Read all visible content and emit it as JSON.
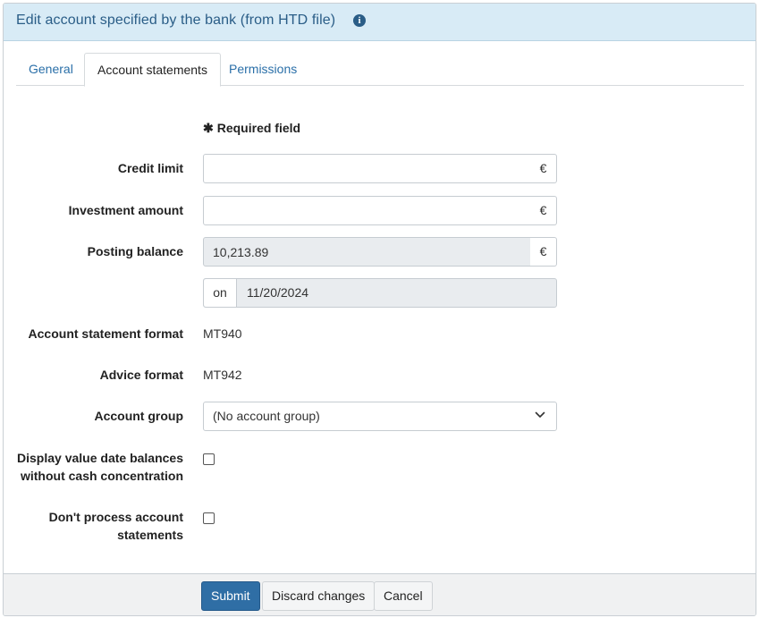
{
  "header": {
    "title": "Edit account specified by the bank (from HTD file)",
    "info_icon": "i"
  },
  "tabs": [
    {
      "label": "General",
      "active": false
    },
    {
      "label": "Account statements",
      "active": true
    },
    {
      "label": "Permissions",
      "active": false
    }
  ],
  "form": {
    "required_star": "✱",
    "required_label": "Required field",
    "credit_limit": {
      "label": "Credit limit",
      "value": "",
      "currency": "€"
    },
    "investment_amount": {
      "label": "Investment amount",
      "value": "",
      "currency": "€"
    },
    "posting_balance": {
      "label": "Posting balance",
      "value": "10,213.89",
      "currency": "€"
    },
    "balance_date": {
      "prefix": "on",
      "value": "11/20/2024"
    },
    "statement_format": {
      "label": "Account statement format",
      "value": "MT940"
    },
    "advice_format": {
      "label": "Advice format",
      "value": "MT942"
    },
    "account_group": {
      "label": "Account group",
      "selected": "(No account group)"
    },
    "value_date_balances": {
      "label_line1": "Display value date balances",
      "label_line2": "without cash concentration",
      "checked": false
    },
    "dont_process": {
      "label_line1": "Don't process account",
      "label_line2": "statements",
      "checked": false
    }
  },
  "footer": {
    "submit": "Submit",
    "discard": "Discard changes",
    "cancel": "Cancel"
  },
  "colors": {
    "header_bg": "#d8ebf6",
    "header_text": "#2a5d87",
    "primary_button": "#2f6ea5",
    "tab_link": "#2a6fa8"
  }
}
